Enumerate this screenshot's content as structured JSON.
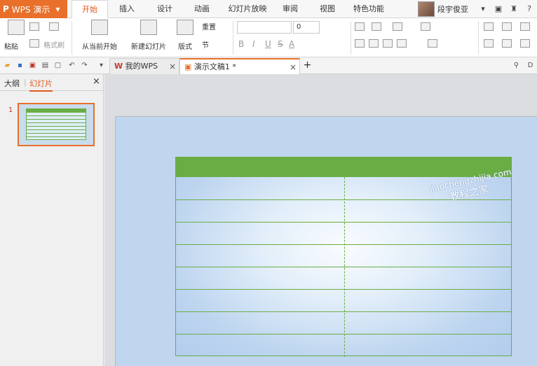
{
  "app": {
    "name": "WPS 演示",
    "logo": "P"
  },
  "tabs": [
    "开始",
    "插入",
    "设计",
    "动画",
    "幻灯片放映",
    "审阅",
    "视图",
    "特色功能"
  ],
  "active_tab": "开始",
  "user": {
    "name": "段宇俊亚"
  },
  "ribbon": {
    "paste": "粘贴",
    "format_painter": "格式刷",
    "from_current": "从当前开始",
    "new_slide": "新建幻灯片",
    "layout": "版式",
    "reset": "重置",
    "section": "节",
    "font_size": "0",
    "bold": "B",
    "italic": "I",
    "underline": "U",
    "strike": "S",
    "font_color": "A"
  },
  "doc_tabs": [
    {
      "label": "我的WPS"
    },
    {
      "label": "演示文稿1 *"
    }
  ],
  "add_tab": "+",
  "side_pane": {
    "tabs": [
      "大纲",
      "幻灯片"
    ],
    "active": "幻灯片",
    "close": "×",
    "slide_number": "1"
  },
  "watermark": {
    "latin": "jiaochengzhijia.com",
    "cn": "教程之家"
  },
  "colors": {
    "accent": "#e8702a",
    "table_green": "#6aad45",
    "slide_bg": "#c0d6ef"
  }
}
